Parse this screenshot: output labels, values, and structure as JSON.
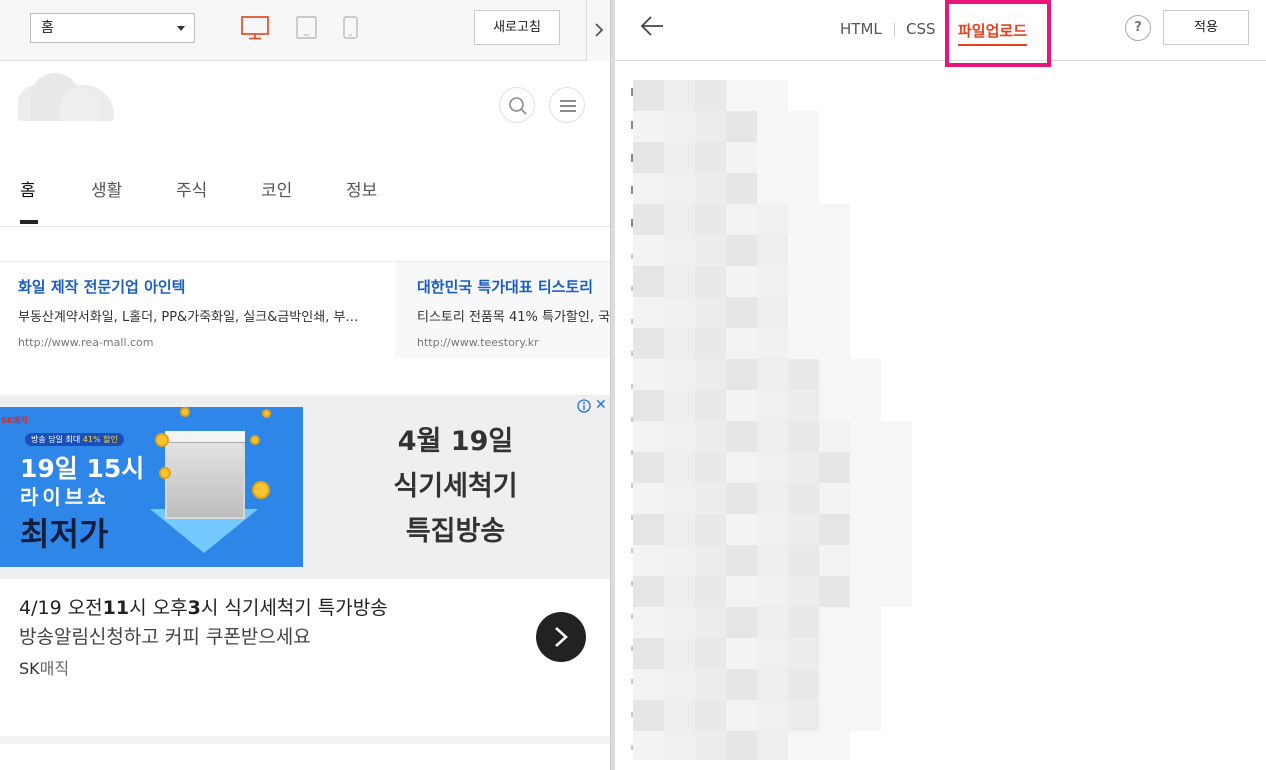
{
  "toolbar_left": {
    "page_select_value": "홈",
    "refresh_label": "새로고침",
    "accent_color": "#e8401c"
  },
  "site": {
    "nav": [
      {
        "label": "홈",
        "active": true
      },
      {
        "label": "생활"
      },
      {
        "label": "주식"
      },
      {
        "label": "코인"
      },
      {
        "label": "정보"
      }
    ]
  },
  "text_ads": [
    {
      "title": "화일 제작 전문기업 아인텍",
      "desc": "부동산계약서화일, L홀더, PP&가죽화일, 실크&금박인쇄, 부…",
      "url": "http://www.rea-mall.com"
    },
    {
      "title": "대한민국 특가대표 티스토리",
      "desc": "티스토리 전품목 41% 특가할인, 국",
      "url": "http://www.teestory.kr"
    }
  ],
  "banner_ad": {
    "image": {
      "brand": "SK매직",
      "tag_prefix": "방송 당일 최대 ",
      "tag_highlight": "41% 할인",
      "line1": "19일 15시",
      "line2": "라이브쇼",
      "line3": "최저가"
    },
    "right_lines": [
      "4월 19일",
      "식기세척기",
      "특집방송"
    ],
    "headline_parts": [
      "4/19 오전",
      "11",
      "시 오후",
      "3",
      "시 식기세척기 특가방송"
    ],
    "subline": "방송알림신청하고 커피 쿠폰받으세요",
    "advertiser_bold": "SK",
    "advertiser_rest": "매직"
  },
  "right_toolbar": {
    "tabs": [
      {
        "label": "HTML"
      },
      {
        "label": "CSS"
      },
      {
        "label": "파일업로드",
        "active": true
      }
    ],
    "help_label": "?",
    "apply_label": "적용",
    "highlight_color": "#e8157a"
  }
}
